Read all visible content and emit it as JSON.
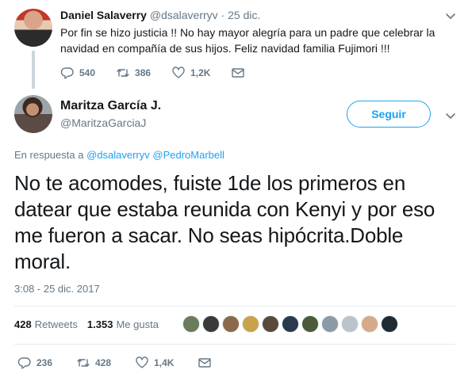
{
  "parent": {
    "name": "Daniel Salaverry",
    "handle": "@dsalaverryv",
    "dot": "·",
    "date": "25 dic.",
    "text": "Por fin se hizo justicia !! No hay mayor alegría para un padre que celebrar la navidad en compañía de sus hijos. Feliz navidad familia Fujimori !!!",
    "replies": "540",
    "retweets": "386",
    "likes": "1,2K"
  },
  "tweet": {
    "name": "Maritza García J.",
    "handle": "@MaritzaGarciaJ",
    "follow_label": "Seguir",
    "reply_prefix": "En respuesta a",
    "reply_handle_1": "@dsalaverryv",
    "reply_handle_2": "@PedroMarbell",
    "text": "No te acomodes,  fuiste 1de los primeros en datear  que estaba reunida con Kenyi y por eso me fueron a sacar. No seas hipócrita.Doble moral.",
    "timestamp": "3:08 - 25 dic. 2017",
    "retweet_count": "428",
    "retweet_label": "Retweets",
    "like_count": "1.353",
    "like_label": "Me gusta",
    "liker_colors": [
      "#6b7c5a",
      "#3a3a3a",
      "#8a6a4a",
      "#c9a24a",
      "#5a4a3a",
      "#2a3a4a",
      "#4a5a3a",
      "#8c9aa6",
      "#b9c4cc",
      "#d6a98a",
      "#1f2a33"
    ],
    "actions": {
      "replies": "236",
      "retweets": "428",
      "likes": "1,4K"
    }
  },
  "colors": {
    "accent": "#1da1f2",
    "secondary_text": "#657786",
    "divider": "#e6ecf0"
  }
}
